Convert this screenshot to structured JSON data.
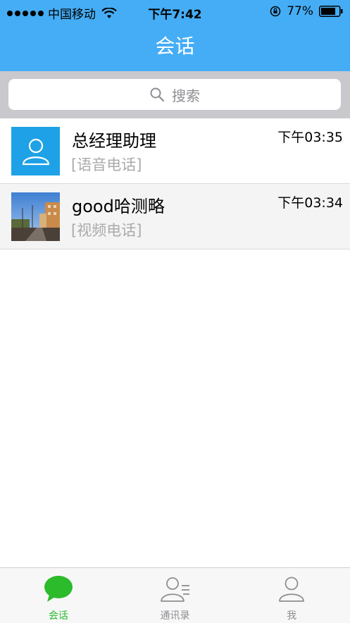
{
  "status_bar": {
    "carrier": "中国移动",
    "time": "下午7:42",
    "battery": "77%"
  },
  "nav": {
    "title": "会话"
  },
  "search": {
    "placeholder": "搜索"
  },
  "conversations": [
    {
      "name": "总经理助理",
      "preview": "[语音电话]",
      "time": "下午03:35",
      "avatar": "person-icon"
    },
    {
      "name": "good哈测略",
      "preview": "[视频电话]",
      "time": "下午03:34",
      "avatar": "photo"
    }
  ],
  "tabs": [
    {
      "label": "会话",
      "icon": "chat-bubble-icon",
      "active": true
    },
    {
      "label": "通讯录",
      "icon": "contacts-icon",
      "active": false
    },
    {
      "label": "我",
      "icon": "me-icon",
      "active": false
    }
  ],
  "colors": {
    "header_blue": "#45adf5",
    "avatar_blue": "#1ea1e6",
    "active_green": "#2bbb2b"
  }
}
